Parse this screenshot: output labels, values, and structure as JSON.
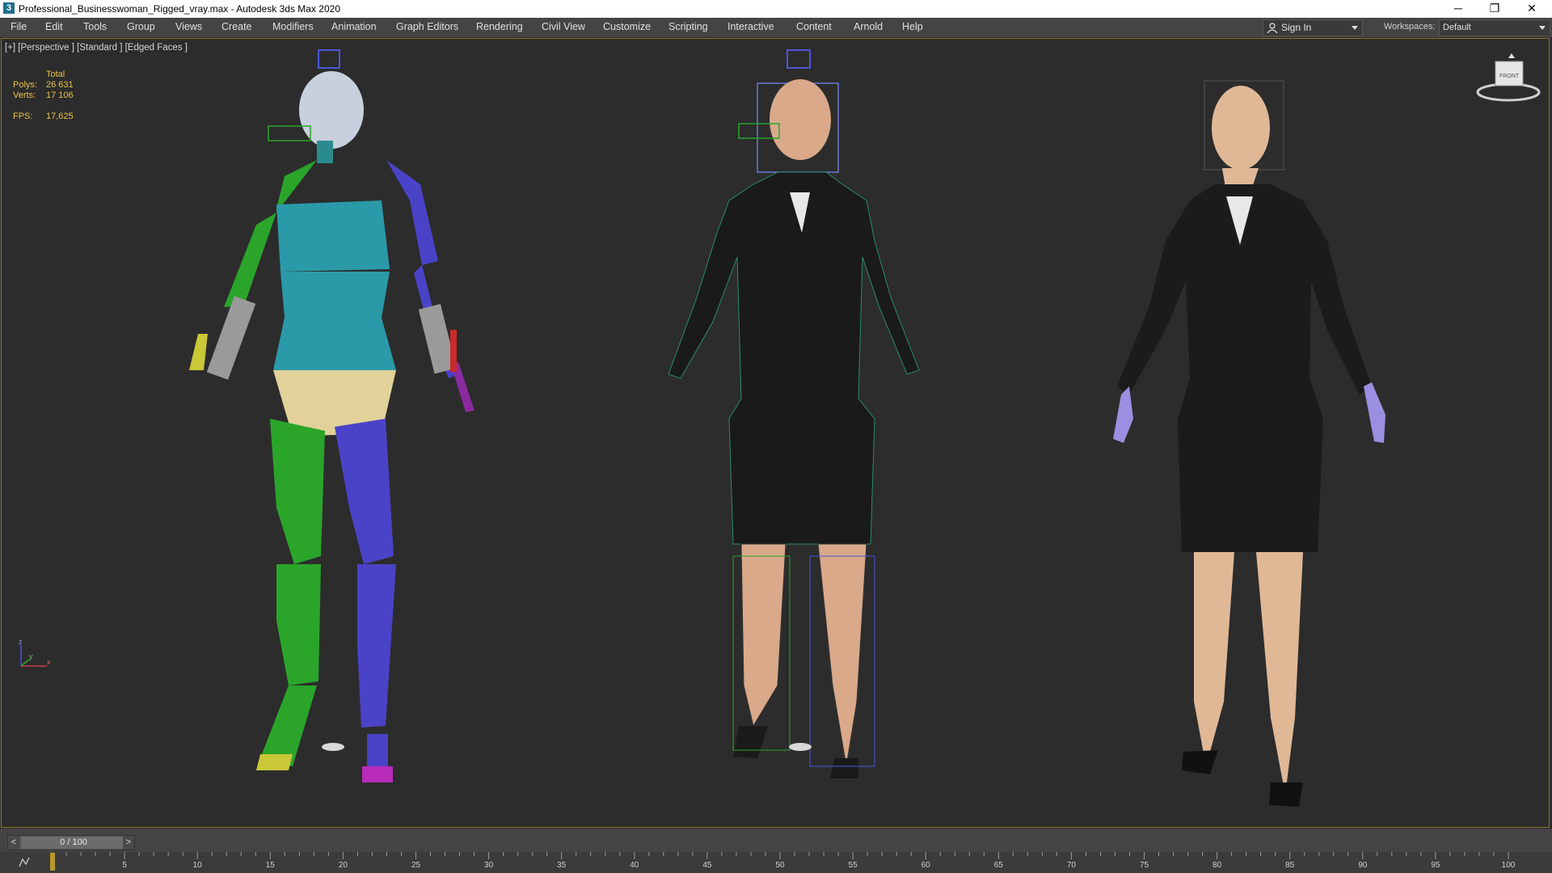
{
  "window": {
    "title": "Professional_Businesswoman_Rigged_vray.max - Autodesk 3ds Max 2020",
    "app_icon": "3",
    "minimize_icon": "─",
    "restore_icon": "❐",
    "close_icon": "✕"
  },
  "menubar": {
    "items": [
      "File",
      "Edit",
      "Tools",
      "Group",
      "Views",
      "Create",
      "Modifiers",
      "Animation",
      "Graph Editors",
      "Rendering",
      "Civil View",
      "Customize",
      "Scripting",
      "Interactive",
      "Content",
      "Arnold",
      "Help"
    ],
    "sign_in": "Sign In",
    "workspaces_label": "Workspaces:",
    "workspace_value": "Default"
  },
  "viewport": {
    "label": "[+] [Perspective ] [Standard ] [Edged Faces ]",
    "stats": {
      "total_label": "Total",
      "polys_label": "Polys:",
      "polys_value": "26 631",
      "verts_label": "Verts:",
      "verts_value": "17 106",
      "fps_label": "FPS:",
      "fps_value": "17,625"
    },
    "viewcube_label": "FRONT",
    "axis_labels": {
      "z": "z",
      "y": "y",
      "x": "x"
    }
  },
  "timeline": {
    "value": "0 / 100",
    "prev": "<",
    "next": ">",
    "ticks": [
      "5",
      "10",
      "15",
      "20",
      "25",
      "30",
      "35",
      "40",
      "45",
      "50",
      "55",
      "60",
      "65",
      "70",
      "75",
      "80",
      "85",
      "90",
      "95",
      "100"
    ]
  },
  "colors": {
    "accent_border": "#8a7a30",
    "stats_text": "#e8c34a",
    "bone_green": "#2aa52a",
    "bone_blue": "#4a43c8",
    "bone_cyan": "#2a9aa8",
    "skin": "#e0b896",
    "suit": "#1a1a1a"
  }
}
